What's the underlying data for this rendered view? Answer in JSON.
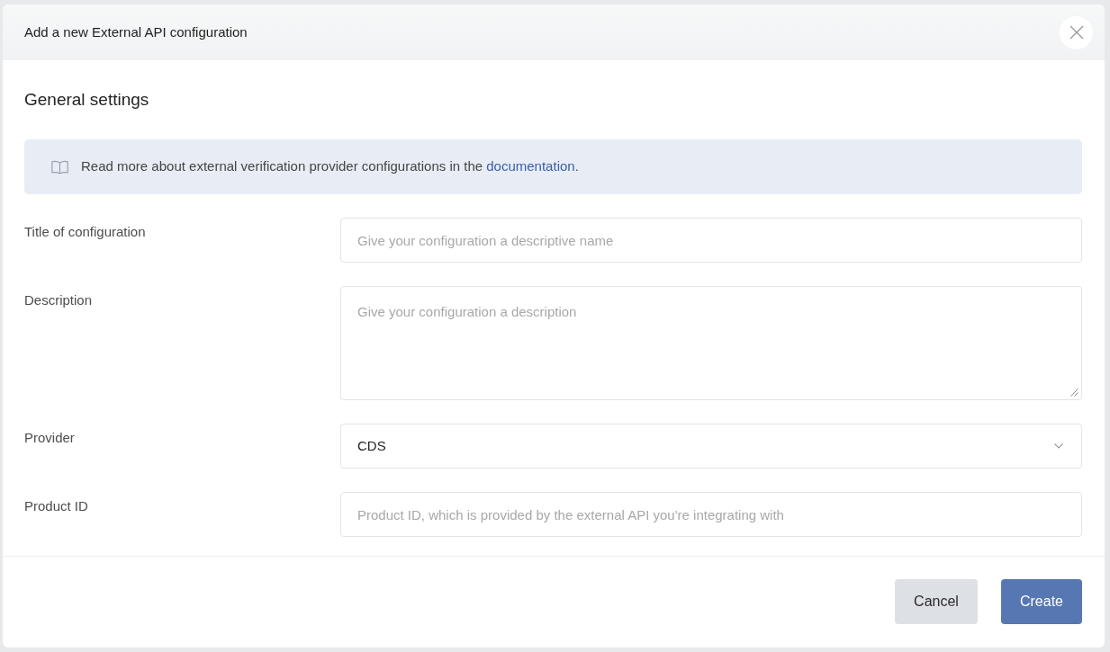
{
  "dialog": {
    "title": "Add a new External API configuration"
  },
  "section_title": "General settings",
  "info": {
    "text": "Read more about external verification provider configurations in the ",
    "link": "documentation",
    "after": "."
  },
  "fields": [
    {
      "kind": "input",
      "label": "Title of configuration",
      "placeholder": "Give your configuration a descriptive name"
    },
    {
      "kind": "textarea",
      "label": "Description",
      "placeholder": "Give your configuration a description"
    },
    {
      "kind": "select",
      "label": "Provider",
      "value": "CDS"
    },
    {
      "kind": "input",
      "label": "Product ID",
      "placeholder": "Product ID, which is provided by the external API you're integrating with"
    }
  ],
  "buttons": [
    {
      "kind": "secondary",
      "label": "Cancel"
    },
    {
      "kind": "primary",
      "label": "Create"
    }
  ]
}
